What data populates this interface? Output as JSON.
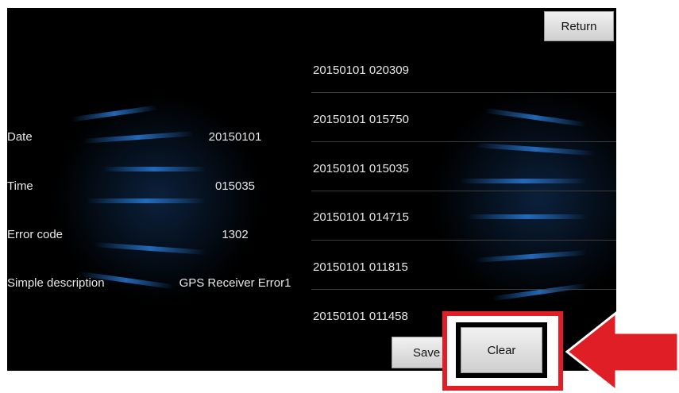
{
  "header": {
    "return_label": "Return"
  },
  "detail": {
    "date_label": "Date",
    "date_value": "20150101",
    "time_label": "Time",
    "time_value": "015035",
    "code_label": "Error code",
    "code_value": "1302",
    "desc_label": "Simple description",
    "desc_value": "GPS Receiver Error1"
  },
  "history": [
    "20150101 020309",
    "20150101 015750",
    "20150101 015035",
    "20150101 014715",
    "20150101 011815",
    "20150101 011458"
  ],
  "footer": {
    "save_label": "Save",
    "clear_label": "Clear"
  },
  "colors": {
    "highlight": "#e01e26",
    "screen_bg": "#000000",
    "accent_blue": "#2878d2"
  },
  "annotation": {
    "arrow_icon": "left-arrow-icon"
  }
}
